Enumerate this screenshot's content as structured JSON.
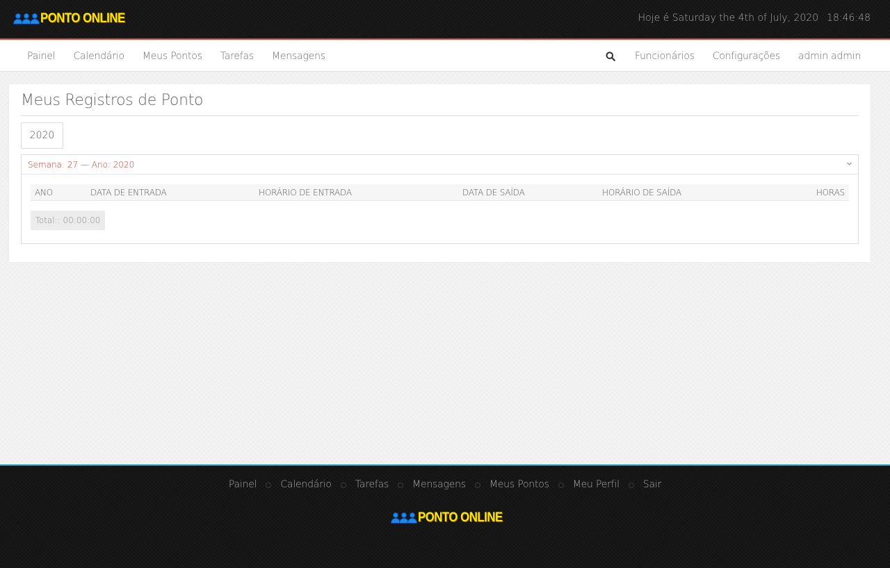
{
  "header": {
    "brand": "PONTO ONLINE",
    "date_text": "Hoje é Saturday the 4th of July, 2020",
    "time_text": "18:46:48"
  },
  "nav": {
    "left_items": [
      {
        "label": "Painel"
      },
      {
        "label": "Calendário"
      },
      {
        "label": "Meus Pontos"
      },
      {
        "label": "Tarefas"
      },
      {
        "label": "Mensagens"
      }
    ],
    "search_icon": "search-icon",
    "right_items": [
      {
        "label": "Funcionários"
      },
      {
        "label": "Configurações"
      },
      {
        "label": "admin admin"
      }
    ]
  },
  "main": {
    "title": "Meus Registros de Ponto",
    "year_tab": "2020",
    "week_panel": {
      "label": "Semana: 27 — Ano: 2020",
      "toggle_icon": "chevron-down-icon",
      "columns": [
        "ANO",
        "DATA DE ENTRADA",
        "HORÁRIO DE ENTRADA",
        "DATA DE SAÍDA",
        "HORÁRIO DE SAÍDA",
        "HORAS"
      ],
      "rows": [],
      "total": "Total:: 00:00:00"
    }
  },
  "footer": {
    "links": [
      {
        "label": "Painel"
      },
      {
        "label": "Calendário"
      },
      {
        "label": "Tarefas"
      },
      {
        "label": "Mensagens"
      },
      {
        "label": "Meus Pontos"
      },
      {
        "label": "Meu Perfil"
      },
      {
        "label": "Sair"
      }
    ],
    "brand": "PONTO ONLINE"
  },
  "colors": {
    "accent_red": "#c0392b",
    "logo_yellow": "#ffe600",
    "logo_blue": "#1e88e5",
    "footer_border": "#2a9bbd"
  }
}
